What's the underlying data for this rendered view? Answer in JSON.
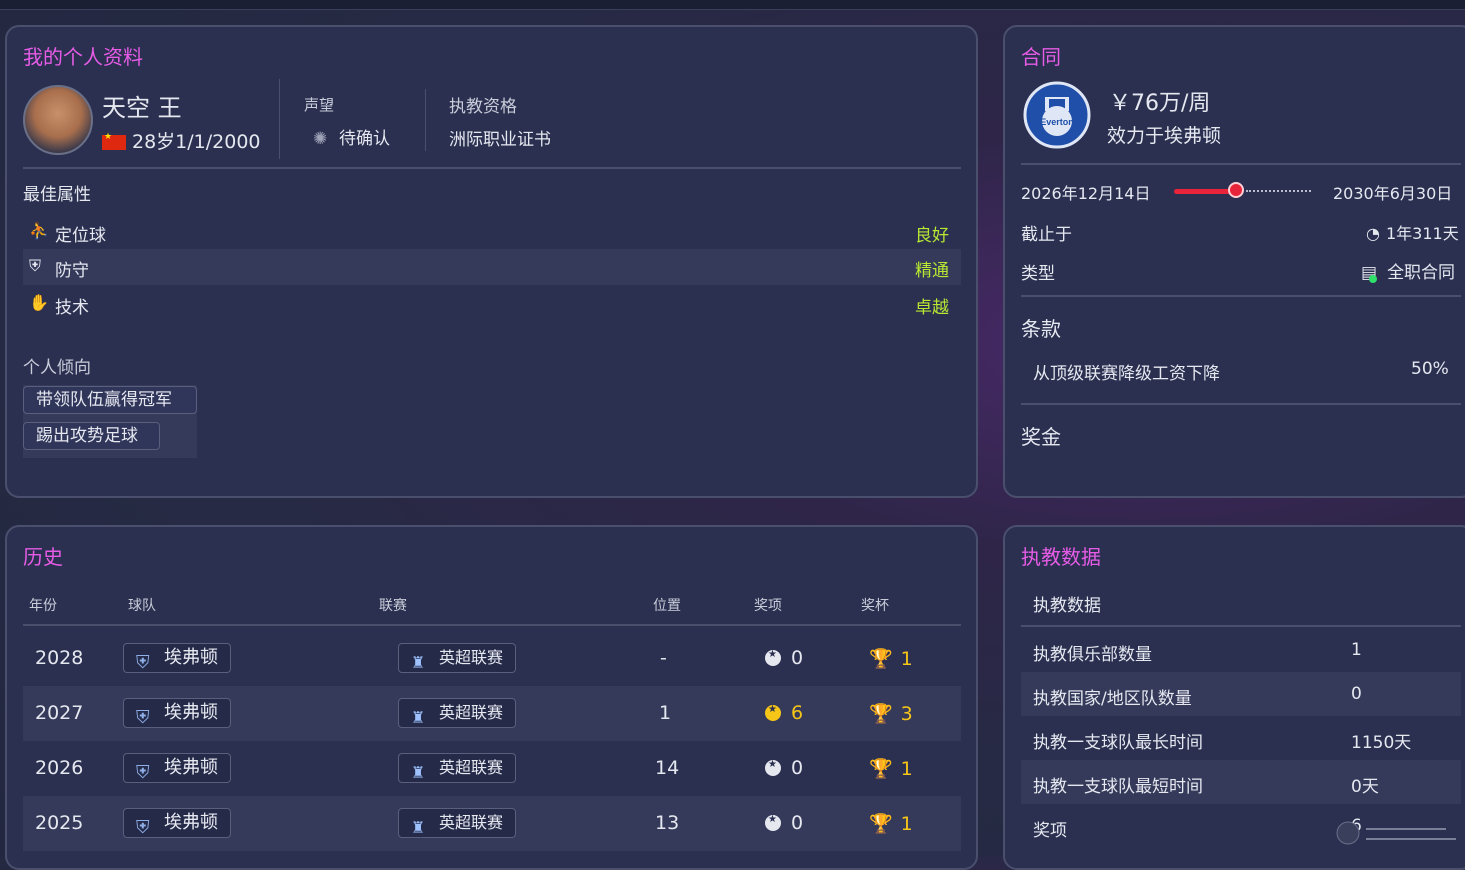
{
  "profile": {
    "title": "我的个人资料",
    "name": "天空 王",
    "age_dob": "28岁1/1/2000",
    "reputation_label": "声望",
    "reputation_value": "待确认",
    "qualification_label": "执教资格",
    "qualification_value": "洲际职业证书",
    "best_attributes_label": "最佳属性",
    "attributes": [
      {
        "icon": "set-piece-icon",
        "label": "定位球",
        "value": "良好"
      },
      {
        "icon": "defense-icon",
        "label": "防守",
        "value": "精通"
      },
      {
        "icon": "technique-icon",
        "label": "技术",
        "value": "卓越"
      }
    ],
    "tendencies_label": "个人倾向",
    "tendencies": [
      "带领队伍赢得冠军",
      "踢出攻势足球"
    ]
  },
  "contract": {
    "title": "合同",
    "wage": "￥76万/周",
    "club_line": "效力于埃弗顿",
    "start_date": "2026年12月14日",
    "end_date": "2030年6月30日",
    "progress": 0.45,
    "expires_label": "截止于",
    "expires_value": "1年311天",
    "type_label": "类型",
    "type_value": "全职合同",
    "terms_label": "条款",
    "terms": [
      {
        "label": "从顶级联赛降级工资下降",
        "value": "50%"
      }
    ],
    "bonus_label": "奖金",
    "badge_text": "Everton"
  },
  "history": {
    "title": "历史",
    "headers": {
      "year": "年份",
      "team": "球队",
      "league": "联赛",
      "position": "位置",
      "awards": "奖项",
      "trophies": "奖杯"
    },
    "rows": [
      {
        "year": "2028",
        "team": "埃弗顿",
        "league": "英超联赛",
        "position": "-",
        "awards": "0",
        "trophies": "1"
      },
      {
        "year": "2027",
        "team": "埃弗顿",
        "league": "英超联赛",
        "position": "1",
        "awards": "6",
        "trophies": "3"
      },
      {
        "year": "2026",
        "team": "埃弗顿",
        "league": "英超联赛",
        "position": "14",
        "awards": "0",
        "trophies": "1"
      },
      {
        "year": "2025",
        "team": "埃弗顿",
        "league": "英超联赛",
        "position": "13",
        "awards": "0",
        "trophies": "1"
      }
    ]
  },
  "stats": {
    "title": "执教数据",
    "subheader": "执教数据",
    "rows": [
      {
        "label": "执教俱乐部数量",
        "value": "1"
      },
      {
        "label": "执教国家/地区队数量",
        "value": "0"
      },
      {
        "label": "执教一支球队最长时间",
        "value": "1150天"
      },
      {
        "label": "执教一支球队最短时间",
        "value": "0天"
      },
      {
        "label": "奖项",
        "value": "6"
      }
    ]
  },
  "colors": {
    "accent": "#e65ce6",
    "good": "#b8e832",
    "gold": "#f5c518",
    "progress": "#e8243a"
  }
}
